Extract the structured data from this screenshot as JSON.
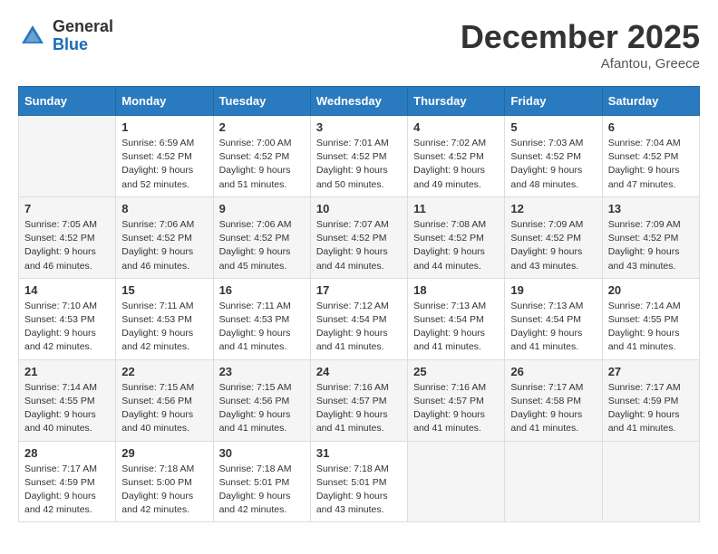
{
  "header": {
    "logo_general": "General",
    "logo_blue": "Blue",
    "month_title": "December 2025",
    "location": "Afantou, Greece"
  },
  "weekdays": [
    "Sunday",
    "Monday",
    "Tuesday",
    "Wednesday",
    "Thursday",
    "Friday",
    "Saturday"
  ],
  "weeks": [
    [
      {
        "day": "",
        "sunrise": "",
        "sunset": "",
        "daylight": ""
      },
      {
        "day": "1",
        "sunrise": "Sunrise: 6:59 AM",
        "sunset": "Sunset: 4:52 PM",
        "daylight": "Daylight: 9 hours and 52 minutes."
      },
      {
        "day": "2",
        "sunrise": "Sunrise: 7:00 AM",
        "sunset": "Sunset: 4:52 PM",
        "daylight": "Daylight: 9 hours and 51 minutes."
      },
      {
        "day": "3",
        "sunrise": "Sunrise: 7:01 AM",
        "sunset": "Sunset: 4:52 PM",
        "daylight": "Daylight: 9 hours and 50 minutes."
      },
      {
        "day": "4",
        "sunrise": "Sunrise: 7:02 AM",
        "sunset": "Sunset: 4:52 PM",
        "daylight": "Daylight: 9 hours and 49 minutes."
      },
      {
        "day": "5",
        "sunrise": "Sunrise: 7:03 AM",
        "sunset": "Sunset: 4:52 PM",
        "daylight": "Daylight: 9 hours and 48 minutes."
      },
      {
        "day": "6",
        "sunrise": "Sunrise: 7:04 AM",
        "sunset": "Sunset: 4:52 PM",
        "daylight": "Daylight: 9 hours and 47 minutes."
      }
    ],
    [
      {
        "day": "7",
        "sunrise": "Sunrise: 7:05 AM",
        "sunset": "Sunset: 4:52 PM",
        "daylight": "Daylight: 9 hours and 46 minutes."
      },
      {
        "day": "8",
        "sunrise": "Sunrise: 7:06 AM",
        "sunset": "Sunset: 4:52 PM",
        "daylight": "Daylight: 9 hours and 46 minutes."
      },
      {
        "day": "9",
        "sunrise": "Sunrise: 7:06 AM",
        "sunset": "Sunset: 4:52 PM",
        "daylight": "Daylight: 9 hours and 45 minutes."
      },
      {
        "day": "10",
        "sunrise": "Sunrise: 7:07 AM",
        "sunset": "Sunset: 4:52 PM",
        "daylight": "Daylight: 9 hours and 44 minutes."
      },
      {
        "day": "11",
        "sunrise": "Sunrise: 7:08 AM",
        "sunset": "Sunset: 4:52 PM",
        "daylight": "Daylight: 9 hours and 44 minutes."
      },
      {
        "day": "12",
        "sunrise": "Sunrise: 7:09 AM",
        "sunset": "Sunset: 4:52 PM",
        "daylight": "Daylight: 9 hours and 43 minutes."
      },
      {
        "day": "13",
        "sunrise": "Sunrise: 7:09 AM",
        "sunset": "Sunset: 4:52 PM",
        "daylight": "Daylight: 9 hours and 43 minutes."
      }
    ],
    [
      {
        "day": "14",
        "sunrise": "Sunrise: 7:10 AM",
        "sunset": "Sunset: 4:53 PM",
        "daylight": "Daylight: 9 hours and 42 minutes."
      },
      {
        "day": "15",
        "sunrise": "Sunrise: 7:11 AM",
        "sunset": "Sunset: 4:53 PM",
        "daylight": "Daylight: 9 hours and 42 minutes."
      },
      {
        "day": "16",
        "sunrise": "Sunrise: 7:11 AM",
        "sunset": "Sunset: 4:53 PM",
        "daylight": "Daylight: 9 hours and 41 minutes."
      },
      {
        "day": "17",
        "sunrise": "Sunrise: 7:12 AM",
        "sunset": "Sunset: 4:54 PM",
        "daylight": "Daylight: 9 hours and 41 minutes."
      },
      {
        "day": "18",
        "sunrise": "Sunrise: 7:13 AM",
        "sunset": "Sunset: 4:54 PM",
        "daylight": "Daylight: 9 hours and 41 minutes."
      },
      {
        "day": "19",
        "sunrise": "Sunrise: 7:13 AM",
        "sunset": "Sunset: 4:54 PM",
        "daylight": "Daylight: 9 hours and 41 minutes."
      },
      {
        "day": "20",
        "sunrise": "Sunrise: 7:14 AM",
        "sunset": "Sunset: 4:55 PM",
        "daylight": "Daylight: 9 hours and 41 minutes."
      }
    ],
    [
      {
        "day": "21",
        "sunrise": "Sunrise: 7:14 AM",
        "sunset": "Sunset: 4:55 PM",
        "daylight": "Daylight: 9 hours and 40 minutes."
      },
      {
        "day": "22",
        "sunrise": "Sunrise: 7:15 AM",
        "sunset": "Sunset: 4:56 PM",
        "daylight": "Daylight: 9 hours and 40 minutes."
      },
      {
        "day": "23",
        "sunrise": "Sunrise: 7:15 AM",
        "sunset": "Sunset: 4:56 PM",
        "daylight": "Daylight: 9 hours and 41 minutes."
      },
      {
        "day": "24",
        "sunrise": "Sunrise: 7:16 AM",
        "sunset": "Sunset: 4:57 PM",
        "daylight": "Daylight: 9 hours and 41 minutes."
      },
      {
        "day": "25",
        "sunrise": "Sunrise: 7:16 AM",
        "sunset": "Sunset: 4:57 PM",
        "daylight": "Daylight: 9 hours and 41 minutes."
      },
      {
        "day": "26",
        "sunrise": "Sunrise: 7:17 AM",
        "sunset": "Sunset: 4:58 PM",
        "daylight": "Daylight: 9 hours and 41 minutes."
      },
      {
        "day": "27",
        "sunrise": "Sunrise: 7:17 AM",
        "sunset": "Sunset: 4:59 PM",
        "daylight": "Daylight: 9 hours and 41 minutes."
      }
    ],
    [
      {
        "day": "28",
        "sunrise": "Sunrise: 7:17 AM",
        "sunset": "Sunset: 4:59 PM",
        "daylight": "Daylight: 9 hours and 42 minutes."
      },
      {
        "day": "29",
        "sunrise": "Sunrise: 7:18 AM",
        "sunset": "Sunset: 5:00 PM",
        "daylight": "Daylight: 9 hours and 42 minutes."
      },
      {
        "day": "30",
        "sunrise": "Sunrise: 7:18 AM",
        "sunset": "Sunset: 5:01 PM",
        "daylight": "Daylight: 9 hours and 42 minutes."
      },
      {
        "day": "31",
        "sunrise": "Sunrise: 7:18 AM",
        "sunset": "Sunset: 5:01 PM",
        "daylight": "Daylight: 9 hours and 43 minutes."
      },
      {
        "day": "",
        "sunrise": "",
        "sunset": "",
        "daylight": ""
      },
      {
        "day": "",
        "sunrise": "",
        "sunset": "",
        "daylight": ""
      },
      {
        "day": "",
        "sunrise": "",
        "sunset": "",
        "daylight": ""
      }
    ]
  ]
}
